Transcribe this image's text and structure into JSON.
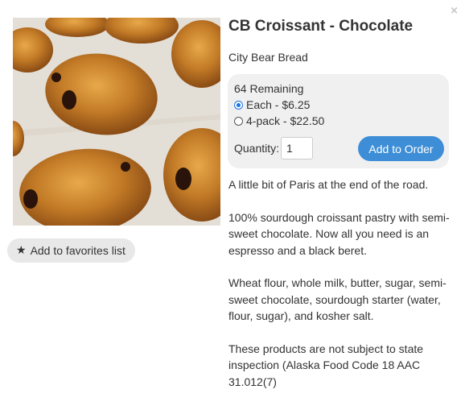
{
  "modal": {
    "close_glyph": "×"
  },
  "product": {
    "image_alt": "Chocolate croissants on parchment",
    "title": "CB Croissant - Chocolate",
    "vendor": "City Bear Bread"
  },
  "order": {
    "remaining": "64 Remaining",
    "options": [
      {
        "label": "Each - $6.25",
        "selected": true
      },
      {
        "label": "4-pack - $22.50",
        "selected": false
      }
    ],
    "quantity_label": "Quantity:",
    "quantity_value": "1",
    "add_button": "Add to Order"
  },
  "favorites": {
    "label": "Add to favorites list",
    "icon": "star-icon"
  },
  "description": [
    "A little bit of Paris at the end of the road.",
    "100% sourdough croissant pastry with semi-sweet chocolate. Now all you need is an espresso and a black beret.",
    "Wheat flour, whole milk, butter, sugar, semi-sweet chocolate, sourdough starter (water, flour, sugar), and kosher salt.",
    "These products are not subject to state inspection (Alaska Food Code 18 AAC 31.012(7)"
  ],
  "colors": {
    "accent": "#3d8ed6",
    "panel": "#f0f0f0",
    "fav_bg": "#e8e8e8",
    "text": "#333333"
  }
}
